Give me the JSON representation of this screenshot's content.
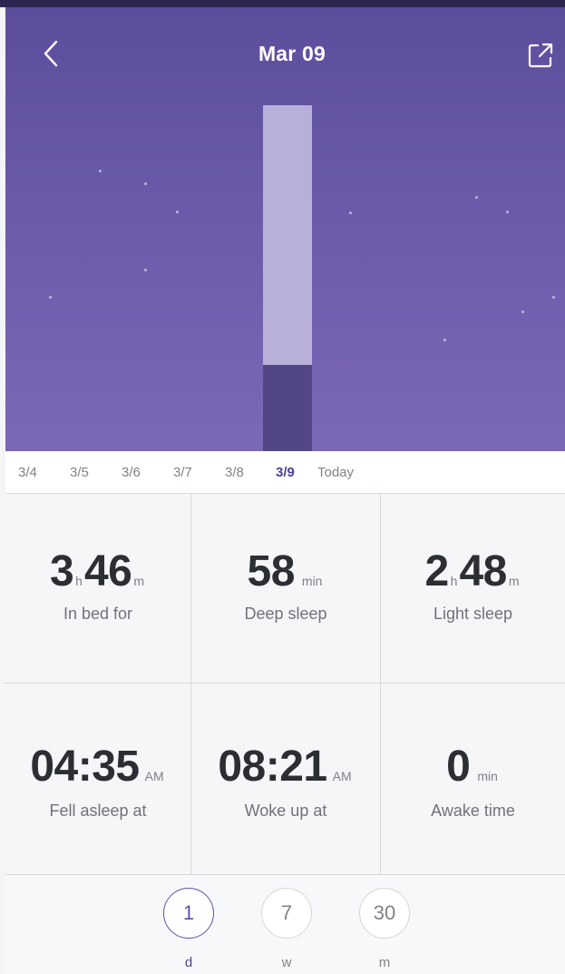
{
  "header": {
    "title": "Mar 09",
    "back_icon": "chevron-left-icon",
    "share_icon": "share-external-icon"
  },
  "chart": {
    "type": "stacked-bar",
    "day": "3/9",
    "deep_sleep_fraction": 0.25,
    "light_sleep_fraction": 0.75,
    "colors": {
      "light": "#b8b0d9",
      "deep": "#534685",
      "background": "#6b5aaa"
    }
  },
  "dates": {
    "items": [
      "3/4",
      "3/5",
      "3/6",
      "3/7",
      "3/8",
      "3/9",
      "Today"
    ],
    "selected": "3/9"
  },
  "stats": {
    "in_bed": {
      "hours": "3",
      "h_unit": "h",
      "minutes": "46",
      "m_unit": "m",
      "label": "In bed for"
    },
    "deep": {
      "value": "58",
      "unit": "min",
      "label": "Deep sleep"
    },
    "light": {
      "hours": "2",
      "h_unit": "h",
      "minutes": "48",
      "m_unit": "m",
      "label": "Light sleep"
    },
    "fell_asleep": {
      "time": "04:35",
      "ampm": "AM",
      "label": "Fell asleep at"
    },
    "woke_up": {
      "time": "08:21",
      "ampm": "AM",
      "label": "Woke up at"
    },
    "awake": {
      "value": "0",
      "unit": "min",
      "label": "Awake time"
    }
  },
  "periods": {
    "items": [
      {
        "count": "1",
        "label": "d"
      },
      {
        "count": "7",
        "label": "w"
      },
      {
        "count": "30",
        "label": "m"
      }
    ],
    "selected_index": 0
  }
}
